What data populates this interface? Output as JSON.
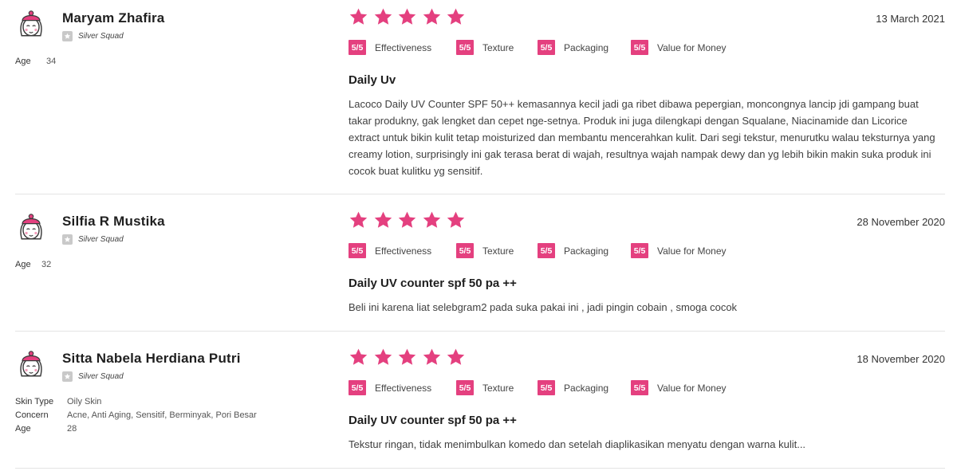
{
  "rating_labels": {
    "effectiveness": "Effectiveness",
    "texture": "Texture",
    "packaging": "Packaging",
    "value": "Value for Money"
  },
  "accent_color": "#e4407f",
  "icons": {
    "avatar": "girl-avatar-icon",
    "badge": "star-badge-icon",
    "star": "star-icon"
  },
  "reviews": [
    {
      "username": "Maryam Zhafira",
      "badge": "Silver Squad",
      "profile": [
        {
          "key": "Age",
          "value": "34"
        }
      ],
      "stars": 5,
      "date": "13 March 2021",
      "scores": {
        "effectiveness": "5/5",
        "texture": "5/5",
        "packaging": "5/5",
        "value": "5/5"
      },
      "title": "Daily Uv",
      "text": "Lacoco Daily UV Counter SPF 50++ kemasannya kecil jadi ga ribet dibawa pepergian, moncongnya lancip jdi gampang buat takar produkny, gak lengket dan cepet nge-setnya. Produk ini juga dilengkapi dengan Squalane, Niacinamide dan Licorice extract untuk bikin kulit tetap moisturized dan membantu mencerahkan kulit. Dari segi tekstur, menurutku walau teksturnya yang creamy lotion, surprisingly ini gak terasa berat di wajah, resultnya wajah nampak dewy dan yg lebih bikin makin suka produk ini cocok buat kulitku yg sensitif."
    },
    {
      "username": "Silfia R Mustika",
      "badge": "Silver Squad",
      "profile": [
        {
          "key": "Age",
          "value": "32"
        }
      ],
      "stars": 5,
      "date": "28 November 2020",
      "scores": {
        "effectiveness": "5/5",
        "texture": "5/5",
        "packaging": "5/5",
        "value": "5/5"
      },
      "title": "Daily UV counter spf 50 pa ++",
      "text": "Beli ini karena liat selebgram2 pada suka pakai ini , jadi pingin cobain , smoga cocok"
    },
    {
      "username": "Sitta Nabela Herdiana Putri",
      "badge": "Silver Squad",
      "profile": [
        {
          "key": "Skin Type",
          "value": "Oily Skin"
        },
        {
          "key": "Concern",
          "value": "Acne, Anti Aging, Sensitif, Berminyak, Pori Besar"
        },
        {
          "key": "Age",
          "value": "28"
        }
      ],
      "stars": 5,
      "date": "18 November 2020",
      "scores": {
        "effectiveness": "5/5",
        "texture": "5/5",
        "packaging": "5/5",
        "value": "5/5"
      },
      "title": "Daily UV counter spf 50 pa ++",
      "text": "Tekstur ringan, tidak menimbulkan komedo dan setelah diaplikasikan menyatu dengan warna kulit..."
    }
  ]
}
